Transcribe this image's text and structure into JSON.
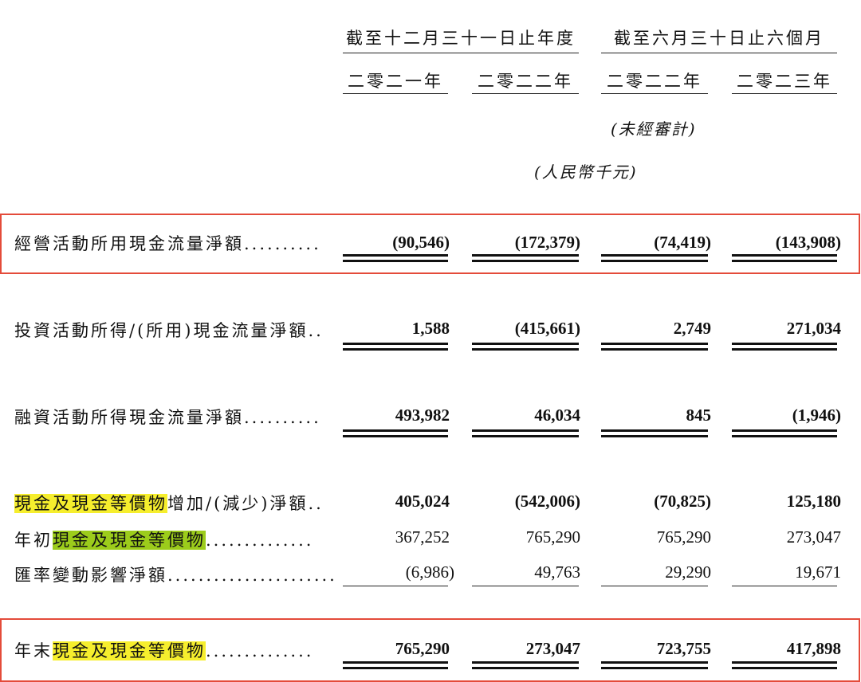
{
  "colors": {
    "highlight_yellow": "#f6ee2d",
    "highlight_green": "#9ccc1b",
    "box_red": "#e44b3a"
  },
  "header": {
    "group1": "截至十二月三十一日止年度",
    "group2": "截至六月三十日止六個月",
    "years": [
      "二零二一年",
      "二零二二年",
      "二零二二年",
      "二零二三年"
    ],
    "unaudited": "(未經審計)",
    "currency": "(人民幣千元)"
  },
  "rows": {
    "operating": {
      "label": "經營活動所用現金流量淨額",
      "leader": "..........",
      "values": [
        "(90,546)",
        "(172,379)",
        "(74,419)",
        "(143,908)"
      ]
    },
    "investing": {
      "label": "投資活動所得/(所用)現金流量淨額",
      "leader": "..",
      "values": [
        "1,588",
        "(415,661)",
        "2,749",
        "271,034"
      ]
    },
    "financing": {
      "label": "融資活動所得現金流量淨額",
      "leader": "..........",
      "values": [
        "493,982",
        "46,034",
        "845",
        "(1,946)"
      ]
    },
    "net_change": {
      "label_hl": "現金及現金等價物",
      "label_rest": "增加/(減少)淨額",
      "leader": "..",
      "values": [
        "405,024",
        "(542,006)",
        "(70,825)",
        "125,180"
      ]
    },
    "beginning": {
      "label_pre": "年初",
      "label_hl": "現金及現金等價物",
      "leader": "..............",
      "values": [
        "367,252",
        "765,290",
        "765,290",
        "273,047"
      ]
    },
    "fx": {
      "label": "匯率變動影響淨額",
      "leader": "......................",
      "values": [
        "(6,986)",
        "49,763",
        "29,290",
        "19,671"
      ]
    },
    "ending": {
      "label_pre": "年末",
      "label_hl": "現金及現金等價物",
      "leader": "..............",
      "values": [
        "765,290",
        "273,047",
        "723,755",
        "417,898"
      ]
    }
  }
}
